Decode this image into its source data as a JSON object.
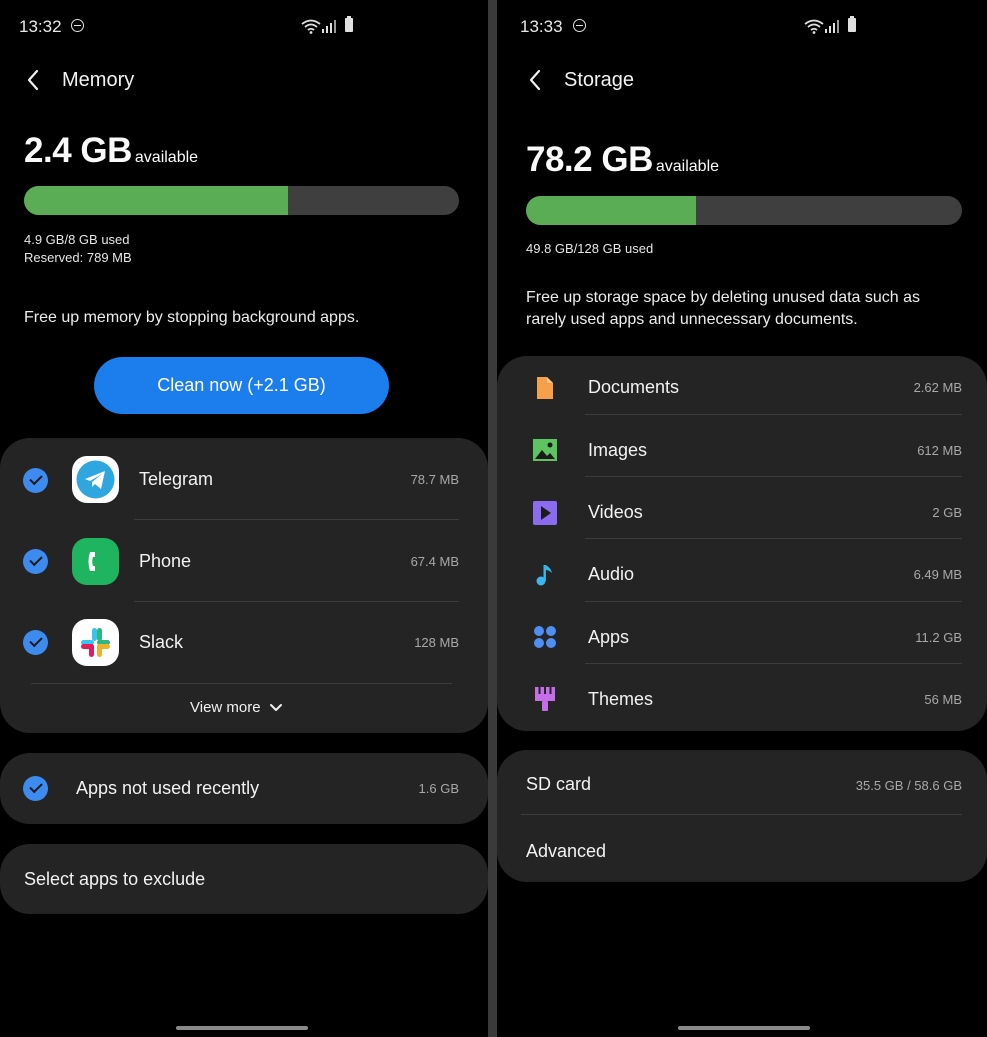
{
  "memory": {
    "status_time": "13:32",
    "title": "Memory",
    "available_value": "2.4 GB",
    "available_label": "available",
    "used_fraction": 0.606,
    "used_text": "4.9 GB/8 GB used",
    "reserved_text": "Reserved: 789 MB",
    "description": "Free up memory by stopping background apps.",
    "clean_button_label": "Clean now (+2.1 GB)",
    "apps": [
      {
        "name": "Telegram",
        "size": "78.7 MB",
        "icon": "telegram-icon"
      },
      {
        "name": "Phone",
        "size": "67.4 MB",
        "icon": "phone-icon"
      },
      {
        "name": "Slack",
        "size": "128 MB",
        "icon": "slack-icon"
      }
    ],
    "view_more_label": "View more",
    "not_used_label": "Apps not used recently",
    "not_used_size": "1.6 GB",
    "exclude_label": "Select apps to exclude"
  },
  "storage": {
    "status_time": "13:33",
    "title": "Storage",
    "available_value": "78.2 GB",
    "available_label": "available",
    "used_fraction": 0.389,
    "used_text": "49.8 GB/128 GB used",
    "description_line1": "Free up storage space by deleting unused data such as",
    "description_line2": "rarely used apps and unnecessary documents.",
    "categories": [
      {
        "label": "Documents",
        "size": "2.62 MB",
        "icon": "document-icon",
        "color": "#f7a04b"
      },
      {
        "label": "Images",
        "size": "612 MB",
        "icon": "image-icon",
        "color": "#5cc461"
      },
      {
        "label": "Videos",
        "size": "2 GB",
        "icon": "video-icon",
        "color": "#8b6bf0"
      },
      {
        "label": "Audio",
        "size": "6.49 MB",
        "icon": "music-note-icon",
        "color": "#3eb4ee"
      },
      {
        "label": "Apps",
        "size": "11.2 GB",
        "icon": "apps-grid-icon",
        "color": "#4f8ff2"
      },
      {
        "label": "Themes",
        "size": "56 MB",
        "icon": "brush-icon",
        "color": "#c56ee8"
      }
    ],
    "sd_card_label": "SD card",
    "sd_card_size": "35.5 GB / 58.6 GB",
    "advanced_label": "Advanced"
  },
  "colors": {
    "accent_blue": "#1c7ded",
    "progress_green": "#5aac55",
    "check_blue": "#3e8bf0",
    "card_bg": "#242424"
  }
}
